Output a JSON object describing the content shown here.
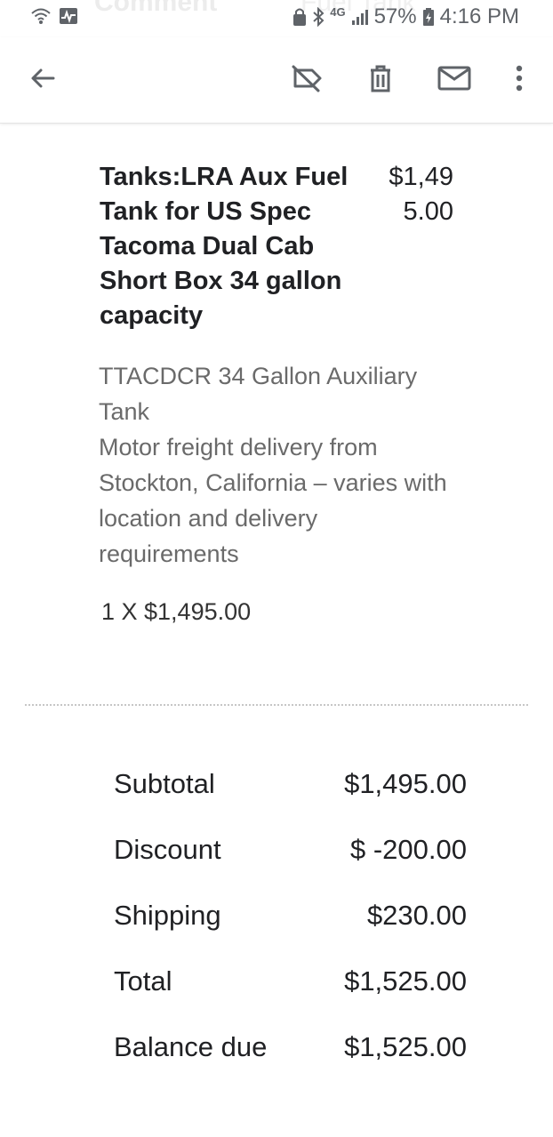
{
  "status_bar": {
    "ghost_left": "Comment",
    "ghost_right": "Fuel Tank",
    "network": "4G",
    "battery": "57%",
    "time": "4:16 PM"
  },
  "toolbar": {
    "back": "back",
    "label": "label-off",
    "delete": "delete",
    "mail": "mark-unread",
    "more": "more"
  },
  "item": {
    "title": "Tanks:LRA Aux Fuel Tank for US Spec Tacoma Dual Cab Short Box 34 gallon capacity",
    "price": "$1,495.00",
    "description_line1": "TTACDCR 34 Gallon Auxiliary Tank",
    "description_line2": "Motor freight delivery from Stockton, California – varies with location and delivery requirements",
    "quantity_line": "1 X $1,495.00"
  },
  "summary": {
    "rows": [
      {
        "label": "Subtotal",
        "value": "$1,495.00"
      },
      {
        "label": "Discount",
        "value": "$ -200.00"
      },
      {
        "label": "Shipping",
        "value": "$230.00"
      },
      {
        "label": "Total",
        "value": "$1,525.00"
      },
      {
        "label": "Balance due",
        "value": "$1,525.00"
      }
    ]
  }
}
